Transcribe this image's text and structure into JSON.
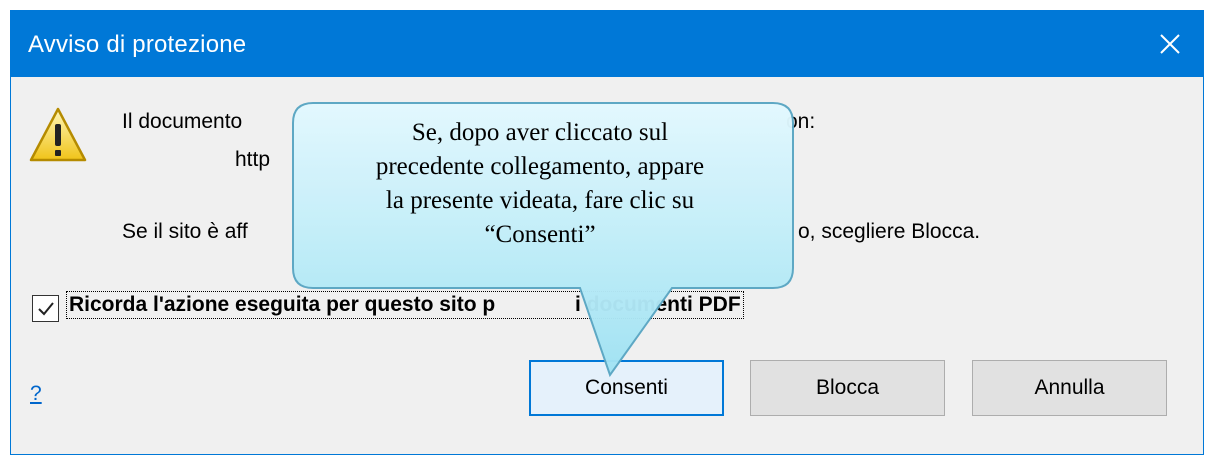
{
  "dialog": {
    "title": "Avviso di protezione",
    "message_line1_start": "Il documento",
    "message_line1_end": "on:",
    "message_line2": "http",
    "message_line3_start": "Se il sito è aff",
    "message_line3_end": "o, scegliere Blocca.",
    "remember_checked": true,
    "remember_label_first": "Ricorda l'azione eseguita per questo sito p",
    "remember_label_last": "i documenti PDF",
    "help_link": "?"
  },
  "buttons": {
    "allow": "Consenti",
    "block": "Blocca",
    "cancel": "Annulla"
  },
  "callout": {
    "text_line1": "Se, dopo aver cliccato sul",
    "text_line2": "precedente collegamento, appare",
    "text_line3": "la presente videata, fare clic su",
    "text_line4": "“Consenti”"
  },
  "colors": {
    "titlebar": "#0078d7",
    "callout_fill": "#bfeefa",
    "callout_stroke": "#5aa6c3"
  }
}
